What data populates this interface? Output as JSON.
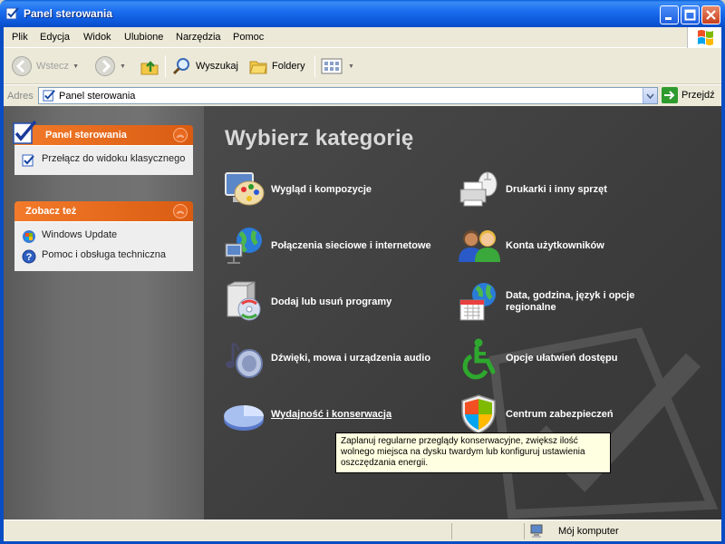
{
  "window": {
    "title": "Panel sterowania"
  },
  "menu": {
    "items": [
      {
        "label": "Plik"
      },
      {
        "label": "Edycja"
      },
      {
        "label": "Widok"
      },
      {
        "label": "Ulubione"
      },
      {
        "label": "Narzędzia"
      },
      {
        "label": "Pomoc"
      }
    ]
  },
  "toolbar": {
    "back_label": "Wstecz",
    "search_label": "Wyszukaj",
    "folders_label": "Foldery"
  },
  "address": {
    "label": "Adres",
    "value": "Panel sterowania",
    "go_label": "Przejdź"
  },
  "left": {
    "cp_panel": {
      "title": "Panel sterowania",
      "tasks": [
        {
          "label": "Przełącz do widoku klasycznego",
          "icon": "switch-view-icon"
        }
      ]
    },
    "see_also": {
      "title": "Zobacz też",
      "tasks": [
        {
          "label": "Windows Update",
          "icon": "windows-update-icon"
        },
        {
          "label": "Pomoc i obsługa techniczna",
          "icon": "help-icon"
        }
      ]
    }
  },
  "main": {
    "heading": "Wybierz kategorię",
    "categories": [
      {
        "label": "Wygląd i kompozycje",
        "icon": "appearance-icon"
      },
      {
        "label": "Drukarki i inny sprzęt",
        "icon": "printer-icon"
      },
      {
        "label": "Połączenia sieciowe i internetowe",
        "icon": "network-icon"
      },
      {
        "label": "Konta użytkowników",
        "icon": "user-accounts-icon"
      },
      {
        "label": "Dodaj lub usuń programy",
        "icon": "add-remove-programs-icon"
      },
      {
        "label": "Data, godzina, język i opcje regionalne",
        "icon": "date-time-icon"
      },
      {
        "label": "Dźwięki, mowa i urządzenia audio",
        "icon": "sounds-icon"
      },
      {
        "label": "Opcje ułatwień dostępu",
        "icon": "accessibility-icon"
      },
      {
        "label": "Wydajność i konserwacja",
        "icon": "performance-icon"
      },
      {
        "label": "Centrum zabezpieczeń",
        "icon": "security-center-icon"
      }
    ],
    "tooltip": "Zaplanuj regularne przeglądy konserwacyjne, zwiększ ilość wolnego miejsca na dysku twardym lub konfiguruj ustawienia oszczędzania energii."
  },
  "status": {
    "zone": "Mój komputer"
  },
  "colors": {
    "titlebar": "#0b55d6",
    "panel_header": "#e8691c",
    "main_bg": "#3e3e3e",
    "tooltip_bg": "#ffffe1"
  }
}
